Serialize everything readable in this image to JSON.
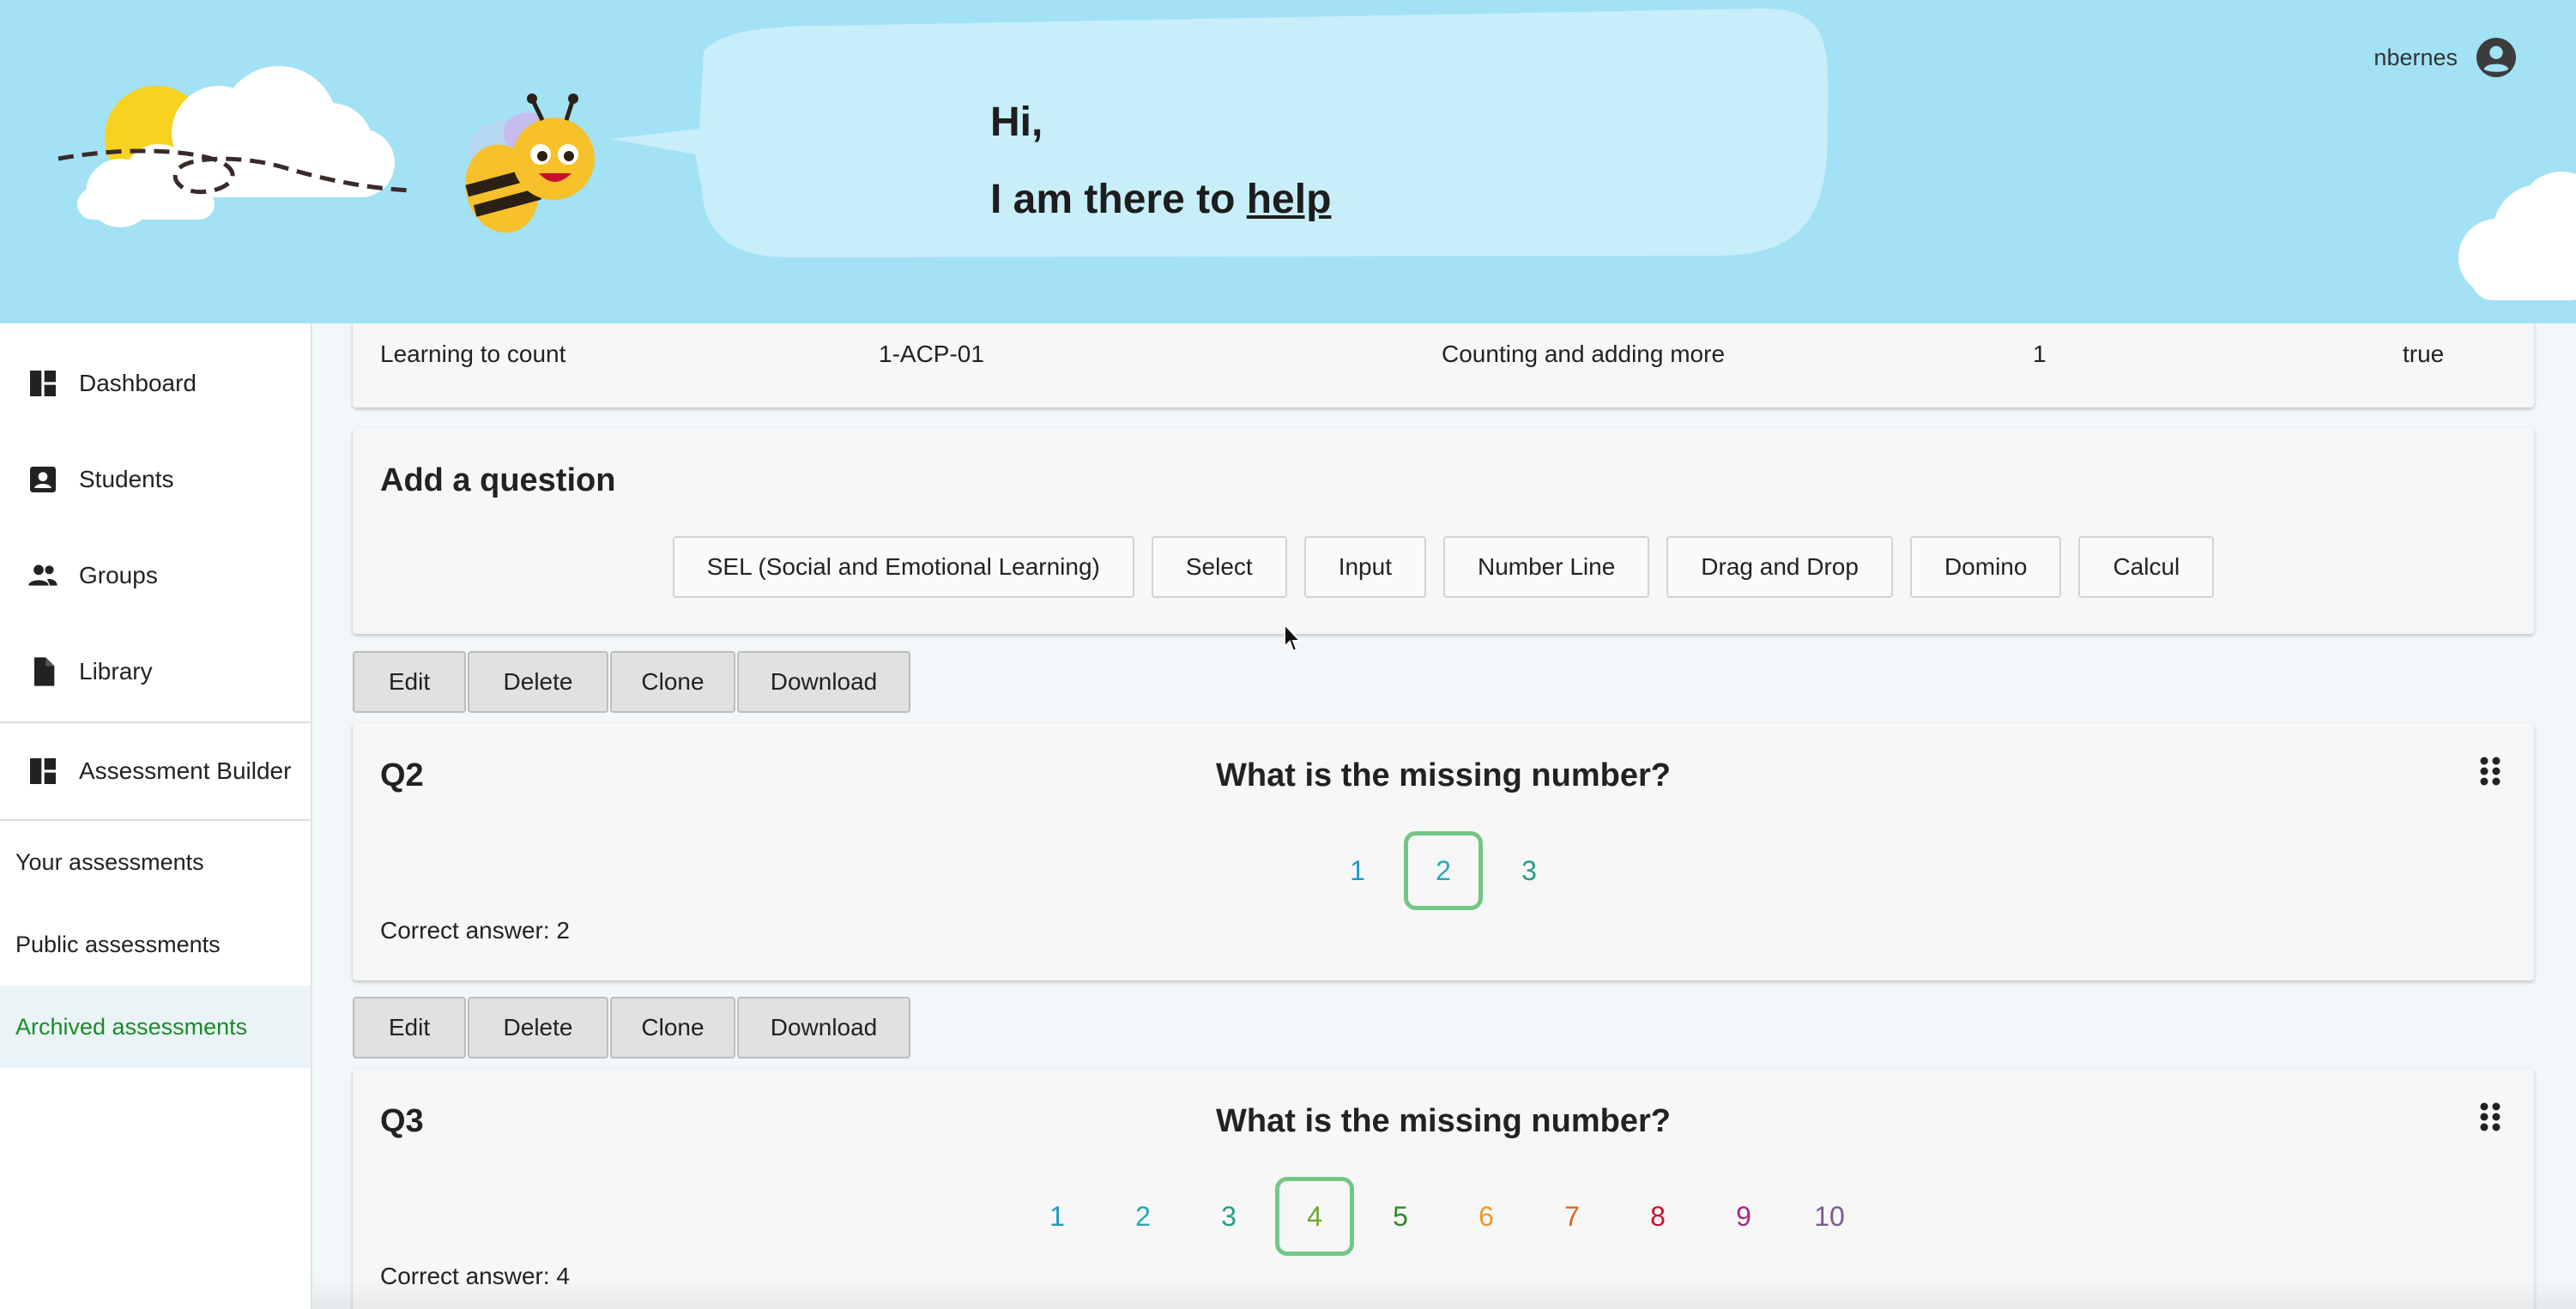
{
  "header": {
    "greeting_line1": "Hi,",
    "greeting_line2_prefix": "I am there to ",
    "greeting_link": "help",
    "user_name": "nbernes",
    "colors": {
      "sky": "#a3e1f5",
      "bubble": "#c7eef9",
      "bee": "#f6c12b"
    }
  },
  "sidebar": {
    "items": [
      {
        "label": "Dashboard",
        "icon": "dashboard-icon"
      },
      {
        "label": "Students",
        "icon": "student-badge-icon"
      },
      {
        "label": "Groups",
        "icon": "groups-icon"
      },
      {
        "label": "Library",
        "icon": "document-icon"
      },
      {
        "label": "Assessment Builder",
        "icon": "dashboard-icon"
      }
    ],
    "sub_items": [
      {
        "label": "Your assessments",
        "active": false
      },
      {
        "label": "Public assessments",
        "active": false
      },
      {
        "label": "Archived assessments",
        "active": true
      }
    ]
  },
  "assessment_row": {
    "name": "Learning to count",
    "code": "1-ACP-01",
    "topic": "Counting and adding more",
    "level": "1",
    "flag": "true"
  },
  "add_question": {
    "title": "Add a question",
    "types": [
      "SEL (Social and Emotional Learning)",
      "Select",
      "Input",
      "Number Line",
      "Drag and Drop",
      "Domino",
      "Calcul"
    ]
  },
  "toolbar": {
    "edit": "Edit",
    "delete": "Delete",
    "clone": "Clone",
    "download": "Download"
  },
  "questions": [
    {
      "label": "Q2",
      "text": "What is the missing number?",
      "options": [
        {
          "value": "1",
          "color": "#1f95c8"
        },
        {
          "value": "2",
          "color": "#2aa7b8"
        },
        {
          "value": "3",
          "color": "#1f9f88"
        }
      ],
      "selected": "2",
      "correct": "Correct answer: 2"
    },
    {
      "label": "Q3",
      "text": "What is the missing number?",
      "options": [
        {
          "value": "1",
          "color": "#1f95c8"
        },
        {
          "value": "2",
          "color": "#2aa7b8"
        },
        {
          "value": "3",
          "color": "#1f9f88"
        },
        {
          "value": "4",
          "color": "#6aaa2a"
        },
        {
          "value": "5",
          "color": "#2a8c2a"
        },
        {
          "value": "6",
          "color": "#ec9a1f"
        },
        {
          "value": "7",
          "color": "#e1651f"
        },
        {
          "value": "8",
          "color": "#c8102e"
        },
        {
          "value": "9",
          "color": "#a32b84"
        },
        {
          "value": "10",
          "color": "#7a5a8e"
        }
      ],
      "selected": "4",
      "correct": "Correct answer: 4"
    }
  ],
  "accent_color": "#1b8a2a"
}
